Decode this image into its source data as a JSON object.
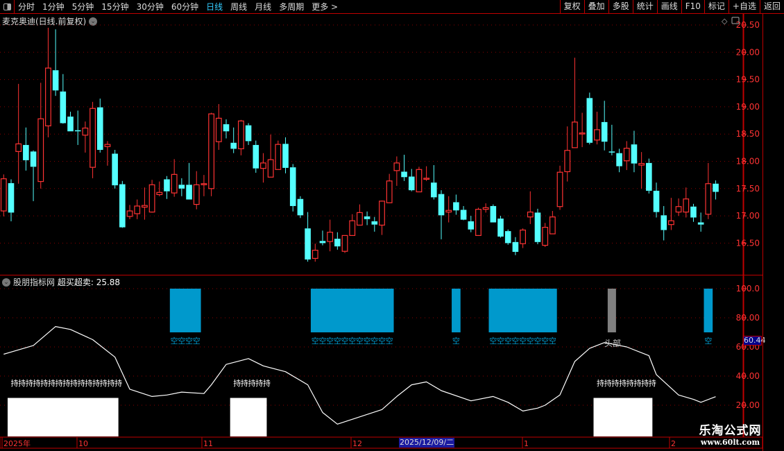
{
  "toolbar": {
    "nav": [
      "分时",
      "1分钟",
      "5分钟",
      "15分钟",
      "30分钟",
      "60分钟",
      "日线",
      "周线",
      "月线",
      "多周期",
      "更多 >"
    ],
    "active": "日线",
    "buttons": [
      "复权",
      "叠加",
      "多股",
      "统计",
      "画线",
      "F10",
      "标记",
      "+自选",
      "返回"
    ]
  },
  "chart_title": "麦克奥迪(日线.前复权)",
  "indicator": {
    "name": "股朋指标网",
    "label": "超买超卖: 25.88",
    "cursor_value": "60.44",
    "sell_text": "空",
    "hold_text": "持",
    "top_text": "头部"
  },
  "time_axis": {
    "labels": [
      "2025年",
      "10",
      "11",
      "12",
      "1",
      "2"
    ],
    "highlight": "2025/12/09/二"
  },
  "watermark": {
    "line1": "乐淘公式网",
    "line2": "www.60lt.com"
  },
  "colors": {
    "up": "#ff3333",
    "down": "#54ffff",
    "grid": "#8b0000",
    "axis": "#ff3333",
    "sell_bar": "#0099cc",
    "top_bar": "#808080",
    "hold_bar": "#ffffff"
  },
  "chart_data": [
    {
      "type": "candlestick",
      "yticks": [
        "20.50",
        "20.00",
        "19.50",
        "19.00",
        "18.50",
        "18.00",
        "17.50",
        "17.00",
        "16.50"
      ],
      "ylim": [
        16.0,
        20.55
      ],
      "ohlc": [
        [
          17.09,
          17.76,
          16.99,
          17.68
        ],
        [
          17.6,
          17.67,
          16.9,
          17.06
        ],
        [
          18.18,
          19.42,
          17.59,
          18.32
        ],
        [
          18.3,
          18.62,
          17.83,
          18.02
        ],
        [
          18.18,
          18.2,
          17.27,
          17.9
        ],
        [
          17.63,
          19.44,
          17.5,
          18.78
        ],
        [
          18.65,
          20.45,
          18.44,
          19.71
        ],
        [
          19.67,
          20.42,
          19.2,
          19.3
        ],
        [
          19.28,
          19.6,
          18.69,
          18.7
        ],
        [
          18.82,
          18.91,
          18.55,
          18.55
        ],
        [
          18.57,
          18.93,
          18.3,
          18.55
        ],
        [
          18.48,
          18.73,
          18.16,
          18.61
        ],
        [
          17.89,
          19.09,
          17.69,
          18.97
        ],
        [
          18.99,
          19.15,
          18.16,
          18.21
        ],
        [
          18.27,
          18.37,
          17.92,
          18.31
        ],
        [
          18.14,
          18.21,
          17.5,
          17.56
        ],
        [
          17.58,
          17.64,
          16.78,
          16.79
        ],
        [
          16.99,
          17.2,
          16.94,
          17.09
        ],
        [
          17.04,
          17.3,
          16.94,
          17.18
        ],
        [
          17.16,
          17.52,
          16.93,
          17.19
        ],
        [
          17.07,
          17.66,
          17.06,
          17.57
        ],
        [
          17.39,
          17.63,
          17.36,
          17.43
        ],
        [
          17.67,
          17.73,
          17.31,
          17.45
        ],
        [
          17.42,
          18.04,
          17.35,
          17.76
        ],
        [
          17.57,
          17.69,
          17.36,
          17.5
        ],
        [
          17.57,
          17.97,
          17.3,
          17.3
        ],
        [
          17.21,
          17.82,
          17.12,
          17.57
        ],
        [
          17.58,
          17.75,
          17.36,
          17.59
        ],
        [
          17.5,
          18.89,
          17.36,
          18.87
        ],
        [
          18.36,
          19.05,
          18.21,
          18.79
        ],
        [
          18.68,
          18.77,
          18.42,
          18.55
        ],
        [
          18.34,
          18.62,
          18.15,
          18.23
        ],
        [
          18.23,
          18.76,
          18.11,
          18.74
        ],
        [
          18.66,
          18.7,
          18.3,
          18.37
        ],
        [
          18.3,
          18.38,
          17.79,
          17.87
        ],
        [
          17.87,
          18.15,
          17.61,
          17.97
        ],
        [
          17.71,
          18.49,
          17.71,
          18.03
        ],
        [
          17.85,
          18.38,
          17.85,
          18.31
        ],
        [
          18.32,
          18.44,
          17.78,
          17.88
        ],
        [
          17.89,
          17.95,
          17.08,
          17.18
        ],
        [
          17.31,
          17.36,
          16.96,
          17.01
        ],
        [
          16.77,
          17.07,
          16.16,
          16.2
        ],
        [
          16.22,
          16.49,
          16.16,
          16.37
        ],
        [
          16.54,
          16.73,
          16.46,
          16.5
        ],
        [
          16.53,
          16.93,
          16.35,
          16.7
        ],
        [
          16.58,
          16.7,
          16.38,
          16.44
        ],
        [
          16.35,
          16.64,
          16.32,
          16.64
        ],
        [
          16.64,
          17.03,
          16.64,
          16.91
        ],
        [
          16.83,
          17.21,
          16.83,
          17.06
        ],
        [
          16.99,
          17.08,
          16.83,
          16.94
        ],
        [
          16.9,
          16.98,
          16.71,
          16.84
        ],
        [
          16.83,
          17.28,
          16.65,
          17.27
        ],
        [
          17.24,
          17.77,
          17.24,
          17.64
        ],
        [
          17.83,
          18.09,
          17.55,
          17.97
        ],
        [
          17.81,
          18.12,
          17.64,
          17.71
        ],
        [
          17.72,
          17.86,
          17.45,
          17.47
        ],
        [
          17.44,
          17.9,
          17.44,
          17.85
        ],
        [
          17.68,
          17.91,
          17.64,
          17.69
        ],
        [
          17.61,
          17.93,
          17.3,
          17.34
        ],
        [
          17.4,
          17.47,
          16.57,
          17.01
        ],
        [
          17.07,
          17.36,
          16.88,
          17.1
        ],
        [
          17.25,
          17.39,
          17.02,
          17.1
        ],
        [
          17.11,
          17.18,
          16.92,
          16.93
        ],
        [
          16.9,
          17.0,
          16.7,
          16.75
        ],
        [
          16.64,
          17.15,
          16.64,
          17.12
        ],
        [
          17.12,
          17.23,
          17.06,
          17.15
        ],
        [
          17.18,
          17.21,
          16.88,
          16.88
        ],
        [
          16.95,
          17.0,
          16.6,
          16.62
        ],
        [
          16.72,
          16.75,
          16.47,
          16.5
        ],
        [
          16.52,
          16.61,
          16.28,
          16.34
        ],
        [
          16.49,
          16.77,
          16.41,
          16.74
        ],
        [
          16.98,
          17.45,
          16.85,
          17.07
        ],
        [
          17.06,
          17.13,
          16.48,
          16.52
        ],
        [
          16.46,
          16.87,
          16.43,
          16.79
        ],
        [
          16.67,
          17.09,
          16.67,
          16.98
        ],
        [
          17.17,
          17.92,
          17.11,
          17.8
        ],
        [
          17.81,
          18.64,
          17.63,
          18.2
        ],
        [
          18.25,
          19.9,
          18.25,
          18.72
        ],
        [
          18.51,
          18.89,
          18.26,
          18.52
        ],
        [
          19.16,
          19.26,
          18.31,
          18.34
        ],
        [
          18.39,
          18.91,
          18.31,
          18.58
        ],
        [
          18.72,
          19.11,
          18.2,
          18.36
        ],
        [
          18.18,
          18.67,
          18.11,
          18.17
        ],
        [
          18.15,
          18.23,
          17.8,
          17.91
        ],
        [
          18.01,
          18.37,
          17.84,
          18.24
        ],
        [
          18.31,
          18.56,
          17.8,
          17.96
        ],
        [
          17.93,
          18.17,
          17.5,
          17.96
        ],
        [
          17.97,
          18.05,
          17.41,
          17.46
        ],
        [
          17.46,
          17.61,
          16.97,
          17.07
        ],
        [
          17.01,
          17.18,
          16.55,
          16.74
        ],
        [
          16.84,
          17.33,
          16.74,
          16.91
        ],
        [
          17.07,
          17.32,
          17.0,
          17.17
        ],
        [
          17.07,
          17.52,
          16.97,
          17.31
        ],
        [
          17.17,
          17.22,
          16.89,
          16.97
        ],
        [
          16.88,
          17.06,
          16.71,
          16.84
        ],
        [
          17.03,
          17.97,
          16.94,
          17.59
        ],
        [
          17.59,
          17.65,
          17.3,
          17.44
        ]
      ]
    },
    {
      "type": "indicator",
      "yticks": [
        "100.0",
        "80.00",
        "60.00",
        "40.00",
        "20.00"
      ],
      "ylim": [
        -1,
        105
      ],
      "line": [
        [
          1,
          55
        ],
        [
          5,
          61
        ],
        [
          8,
          74
        ],
        [
          10,
          72
        ],
        [
          13,
          65
        ],
        [
          16,
          53
        ],
        [
          18,
          31
        ],
        [
          21,
          26
        ],
        [
          23,
          27
        ],
        [
          25,
          29
        ],
        [
          28,
          28
        ],
        [
          29,
          34
        ],
        [
          31,
          48
        ],
        [
          34,
          52
        ],
        [
          36,
          47
        ],
        [
          39,
          43
        ],
        [
          42,
          34
        ],
        [
          44,
          15
        ],
        [
          46,
          7
        ],
        [
          49,
          12
        ],
        [
          52,
          17
        ],
        [
          54,
          26
        ],
        [
          56,
          34
        ],
        [
          58,
          36
        ],
        [
          60,
          30
        ],
        [
          64,
          23
        ],
        [
          67,
          26
        ],
        [
          69,
          22
        ],
        [
          71,
          16
        ],
        [
          73,
          18
        ],
        [
          74,
          20
        ],
        [
          76,
          27
        ],
        [
          78,
          50
        ],
        [
          80,
          59
        ],
        [
          82,
          63
        ],
        [
          85,
          60
        ],
        [
          88,
          54
        ],
        [
          89,
          41
        ],
        [
          92,
          27
        ],
        [
          94,
          24
        ],
        [
          95,
          22
        ],
        [
          97,
          25.88
        ]
      ],
      "sell_signals": [
        [
          24,
          27
        ],
        [
          43,
          53
        ],
        [
          62,
          62
        ],
        [
          67,
          75
        ],
        [
          96,
          96
        ]
      ],
      "sell_range": [
        70,
        100
      ],
      "top_signals": [
        [
          83,
          83
        ]
      ],
      "hold_signals": [
        [
          2,
          16
        ],
        [
          32,
          36
        ],
        [
          81,
          88
        ]
      ],
      "hold_range": [
        0,
        25
      ]
    }
  ]
}
